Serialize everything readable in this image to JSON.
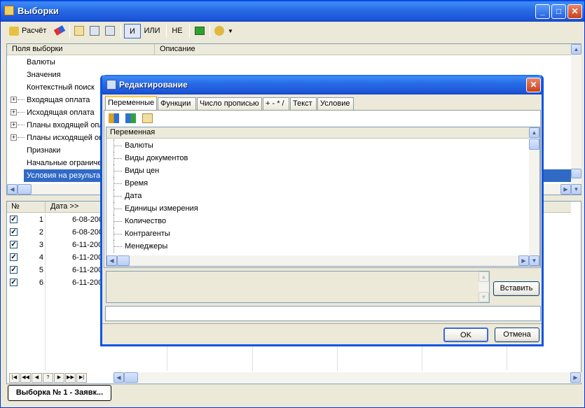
{
  "window": {
    "title": "Выборки"
  },
  "toolbar": {
    "calc": "Расчёт",
    "and": "И",
    "or": "ИЛИ",
    "not": "НЕ"
  },
  "fields_panel": {
    "col1": "Поля выборки",
    "col2": "Описание",
    "items": [
      {
        "label": "Валюты",
        "expandable": false
      },
      {
        "label": "Значения",
        "expandable": false
      },
      {
        "label": "Контекстный поиск",
        "expandable": false
      },
      {
        "label": "Входящая оплата",
        "expandable": true
      },
      {
        "label": "Исходящая оплата",
        "expandable": true
      },
      {
        "label": "Планы входящей опл",
        "expandable": true
      },
      {
        "label": "Планы исходящей оп",
        "expandable": true
      },
      {
        "label": "Признаки",
        "expandable": false
      },
      {
        "label": "Начальные ограничен",
        "expandable": false
      },
      {
        "label": "Условия на результа",
        "expandable": false,
        "selected": true
      }
    ]
  },
  "results": {
    "col_num": "№",
    "col_date": "Дата >>",
    "rows": [
      {
        "n": "1",
        "date": "6-08-200"
      },
      {
        "n": "2",
        "date": "6-08-200"
      },
      {
        "n": "3",
        "date": "6-11-200"
      },
      {
        "n": "4",
        "date": "6-11-200"
      },
      {
        "n": "5",
        "date": "6-11-200"
      },
      {
        "n": "6",
        "date": "6-11-200"
      }
    ],
    "nav": [
      "|◀",
      "◀◀",
      "◀",
      "?",
      "▶",
      "▶▶",
      "▶|"
    ]
  },
  "bottom_tab": "Выборка № 1 - Заявк...",
  "dialog": {
    "title": "Редактирование",
    "tabs": [
      "Переменные",
      "Функции",
      "Число прописью",
      "+ - * /",
      "Текст",
      "Условие"
    ],
    "var_header": "Переменная",
    "vars": [
      "Валюты",
      "Виды документов",
      "Виды цен",
      "Время",
      "Дата",
      "Единицы измерения",
      "Количество",
      "Контрагенты",
      "Менеджеры"
    ],
    "insert": "Вставить",
    "input_value": "",
    "ok": "OK",
    "cancel": "Отмена"
  }
}
